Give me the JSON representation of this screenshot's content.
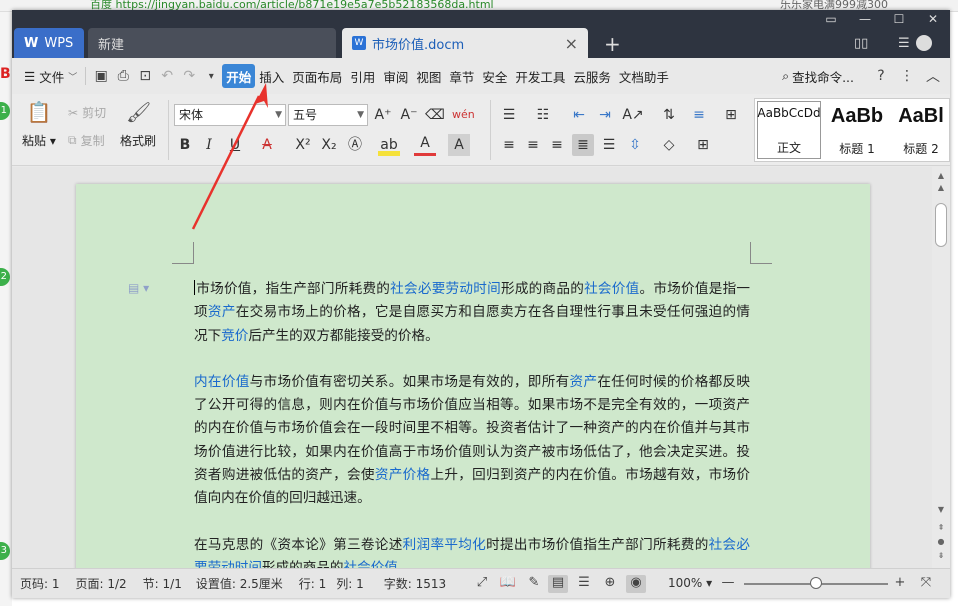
{
  "browser": {
    "url": "百度  https://jingyan.baidu.com/article/b871e19e5a7e5b52183568da.html",
    "right_text": "乐乐家电满999减300"
  },
  "titlebar": {
    "wps_tab": "WPS",
    "new_tab": "新建",
    "doc_tab": "市场价值.docm"
  },
  "menubar": {
    "file": "文件",
    "tabs": [
      "开始",
      "插入",
      "页面布局",
      "引用",
      "审阅",
      "视图",
      "章节",
      "安全",
      "开发工具",
      "云服务",
      "文档助手"
    ],
    "active_tab": "开始",
    "search": "查找命令...",
    "help": "?"
  },
  "ribbon": {
    "paste": "粘贴",
    "cut": "剪切",
    "copy": "复制",
    "format_painter": "格式刷",
    "font_name": "宋体",
    "font_size": "五号",
    "styles": [
      {
        "preview": "AaBbCcDd",
        "name": "正文"
      },
      {
        "preview": "AaBb",
        "name": "标题 1"
      },
      {
        "preview": "AaBl",
        "name": "标题 2"
      }
    ]
  },
  "document": {
    "paragraphs": [
      [
        {
          "t": "市场价值，指生产部门所耗费的"
        },
        {
          "t": "社会必要劳动时间",
          "link": true
        },
        {
          "t": "形成的商品的"
        },
        {
          "t": "社会价值",
          "link": true
        },
        {
          "t": "。市场价值是指一项"
        },
        {
          "t": "资产",
          "link": true
        },
        {
          "t": "在交易市场上的价格，它是自愿买方和自愿卖方在各自理性行事且未受任何强迫的情况下"
        },
        {
          "t": "竞价",
          "link": true
        },
        {
          "t": "后产生的双方都能接受的价格。"
        }
      ],
      [
        {
          "t": "内在价值",
          "link": true
        },
        {
          "t": "与市场价值有密切关系。如果市场是有效的，即所有"
        },
        {
          "t": "资产",
          "link": true
        },
        {
          "t": "在任何时候的价格都反映了公开可得的信息，则内在价值与市场价值应当相等。如果市场不是完全有效的，一项资产的内在价值与市场价值会在一段时间里不相等。投资者估计了一种资产的内在价值并与其市场价值进行比较，如果内在价值高于市场价值则认为资产被市场低估了，他会决定买进。投资者购进被低估的资产，会使"
        },
        {
          "t": "资产价格",
          "link": true
        },
        {
          "t": "上升，回归到资产的内在价值。市场越有效，市场价值向内在价值的回归越迅速。"
        }
      ],
      [
        {
          "t": "在马克思的《资本论》第三卷论述"
        },
        {
          "t": "利润率平均化",
          "link": true
        },
        {
          "t": "时提出市场价值指生产部门所耗费的"
        },
        {
          "t": "社会必要劳动时间",
          "link": true
        },
        {
          "t": "形成的商品的"
        },
        {
          "t": "社会价值",
          "link": true
        },
        {
          "t": "。"
        }
      ]
    ]
  },
  "statusbar": {
    "page_code": "页码: 1",
    "pages": "页面: 1/2",
    "section": "节: 1/1",
    "setting": "设置值: 2.5厘米",
    "row": "行: 1",
    "col": "列: 1",
    "word_count": "字数: 1513",
    "zoom": "100%",
    "zoom_fraction": 0.5
  },
  "colors": {
    "titlebar": "#2e3440",
    "active_tab": "#3a86d6",
    "page_bg": "#cfe8cc",
    "link": "#1a6acd",
    "annotation": "#e8322c"
  }
}
